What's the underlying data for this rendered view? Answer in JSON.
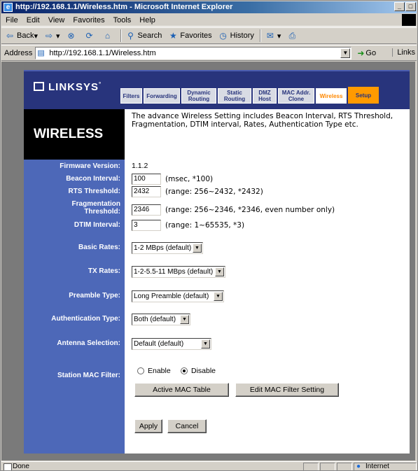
{
  "window": {
    "title": "http://192.168.1.1/Wireless.htm - Microsoft Internet Explorer"
  },
  "menu": [
    "File",
    "Edit",
    "View",
    "Favorites",
    "Tools",
    "Help"
  ],
  "toolbar": {
    "back": "Back",
    "search": "Search",
    "favorites": "Favorites",
    "history": "History"
  },
  "address": {
    "label": "Address",
    "url": "http://192.168.1.1/Wireless.htm",
    "go": "Go",
    "links": "Links"
  },
  "status": {
    "text": "Done",
    "zone": "Internet"
  },
  "router": {
    "logo": "LINKSYS",
    "tabs": [
      {
        "label": "Filters"
      },
      {
        "label": "Forwarding"
      },
      {
        "label": "Dynamic Routing"
      },
      {
        "label": "Static Routing"
      },
      {
        "label": "DMZ Host"
      },
      {
        "label": "MAC Addr. Clone"
      },
      {
        "label": "Wireless"
      },
      {
        "label": "Setup"
      }
    ],
    "page_title": "WIRELESS",
    "description": "The advance Wireless Setting includes Beacon Interval, RTS Threshold, Fragmentation, DTIM interval, Rates, Authentication Type etc."
  },
  "form": {
    "firmware_label": "Firmware Version:",
    "firmware_value": "1.1.2",
    "beacon_label": "Beacon Interval:",
    "beacon_value": "100",
    "beacon_hint": "(msec, *100)",
    "rts_label": "RTS Threshold:",
    "rts_value": "2432",
    "rts_hint": "(range: 256~2432, *2432)",
    "frag_label": "Fragmentation Threshold:",
    "frag_value": "2346",
    "frag_hint": "(range: 256~2346, *2346, even number only)",
    "dtim_label": "DTIM Interval:",
    "dtim_value": "3",
    "dtim_hint": "(range: 1~65535, *3)",
    "basic_rates_label": "Basic Rates:",
    "basic_rates_value": "1-2 MBps (default)",
    "tx_rates_label": "TX Rates:",
    "tx_rates_value": "1-2-5.5-11 MBps (default)",
    "preamble_label": "Preamble Type:",
    "preamble_value": "Long Preamble (default)",
    "auth_label": "Authentication Type:",
    "auth_value": "Both (default)",
    "antenna_label": "Antenna Selection:",
    "antenna_value": "Default (default)",
    "mac_filter_label": "Station MAC Filter:",
    "enable_label": "Enable",
    "disable_label": "Disable",
    "mac_filter_selected": "Disable",
    "active_mac_button": "Active MAC Table",
    "edit_mac_button": "Edit MAC Filter Setting",
    "apply_button": "Apply",
    "cancel_button": "Cancel"
  }
}
